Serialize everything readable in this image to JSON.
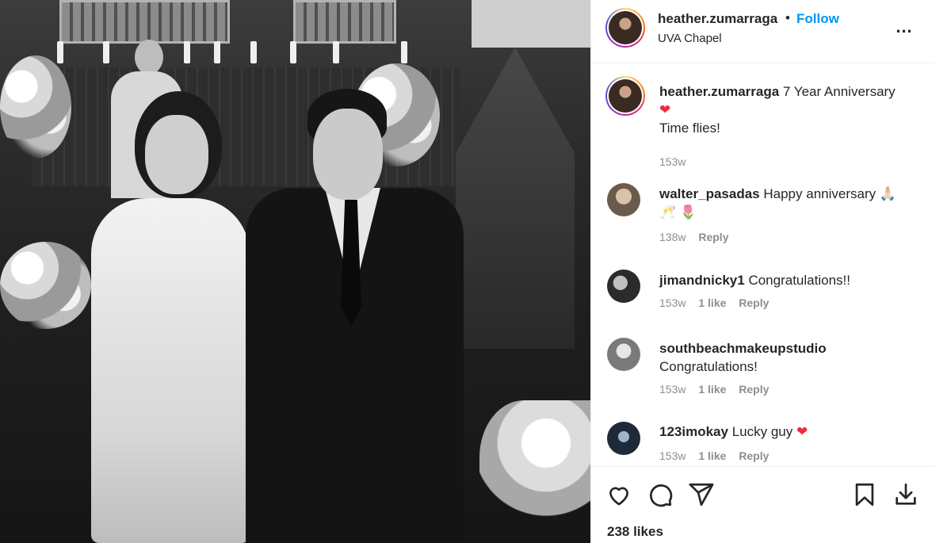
{
  "post": {
    "username": "heather.zumarraga",
    "follow_label": "Follow",
    "separator": "•",
    "location": "UVA Chapel",
    "more_icon": "…"
  },
  "caption": {
    "username": "heather.zumarraga",
    "text_line1": "7 Year Anniversary",
    "emoji": "❤",
    "text_line2": "Time flies!",
    "time": "153w"
  },
  "comments": [
    {
      "username": "walter_pasadas",
      "text": "Happy anniversary",
      "emoji": "🙏🏻 🥂 🌷",
      "time": "138w",
      "likes": "",
      "reply": "Reply"
    },
    {
      "username": "jimandnicky1",
      "text": "Congratulations!!",
      "emoji": "",
      "time": "153w",
      "likes": "1 like",
      "reply": "Reply"
    },
    {
      "username": "southbeachmakeupstudio",
      "text": "Congratulations!",
      "emoji": "",
      "time": "153w",
      "likes": "1 like",
      "reply": "Reply"
    },
    {
      "username": "123imokay",
      "text": "Lucky guy",
      "emoji": "❤",
      "time": "153w",
      "likes": "1 like",
      "reply": "Reply"
    }
  ],
  "actions": {
    "icons": [
      "heart-icon",
      "comment-icon",
      "share-icon",
      "bookmark-icon",
      "download-icon"
    ],
    "likes": "238 likes"
  },
  "colors": {
    "accent": "#0095f6",
    "heart": "#ed2b3f",
    "muted": "#8e8e8e",
    "text": "#262626"
  }
}
